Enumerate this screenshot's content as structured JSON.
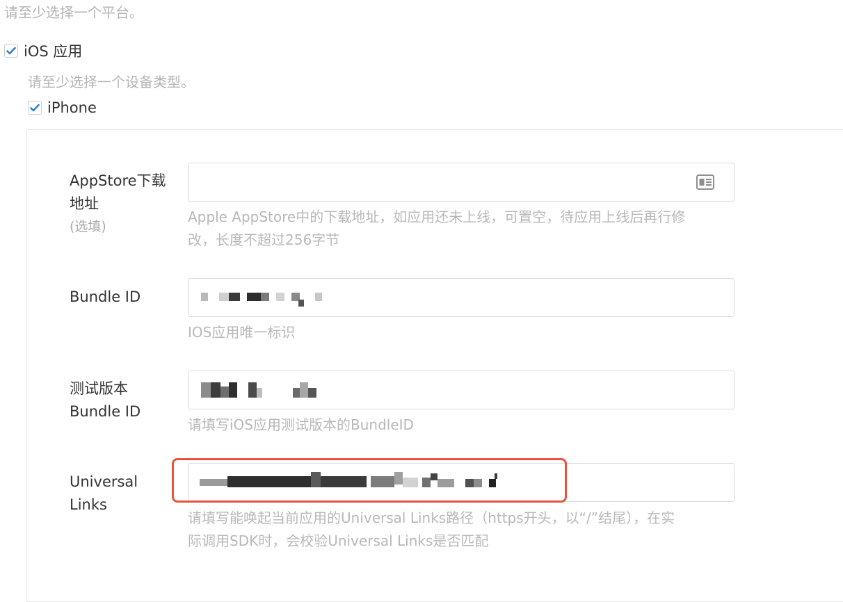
{
  "platform": {
    "hint": "请至少选择一个平台。",
    "ios_label": "iOS 应用",
    "ios_checked": true
  },
  "device": {
    "hint": "请至少选择一个设备类型。",
    "iphone_label": "iPhone",
    "iphone_checked": true
  },
  "form": {
    "appstore": {
      "label_line1": "AppStore下载",
      "label_line2": "地址",
      "label_optional": "(选填)",
      "value": "",
      "desc_line1": "Apple AppStore中的下载地址，如应用还未上线，可置空，待应用上线后再行修",
      "desc_line2": "改，长度不超过256字节"
    },
    "bundle_id": {
      "label": "Bundle ID",
      "desc": "IOS应用唯一标识"
    },
    "test_bundle_id": {
      "label_line1": "测试版本",
      "label_line2": "Bundle ID",
      "desc": "请填写iOS应用测试版本的BundleID"
    },
    "universal_links": {
      "label_line1": "Universal",
      "label_line2": "Links",
      "desc_line1": "请填写能唤起当前应用的Universal Links路径（https开头，以“/”结尾），在实",
      "desc_line2": "际调用SDK时，会校验Universal Links是否匹配"
    }
  },
  "colors": {
    "checkbox_tick": "#2f7fd8",
    "highlight_border": "#e8533b"
  },
  "icons": {
    "checkbox": "check-icon",
    "appstore_field": "id-card-icon"
  }
}
